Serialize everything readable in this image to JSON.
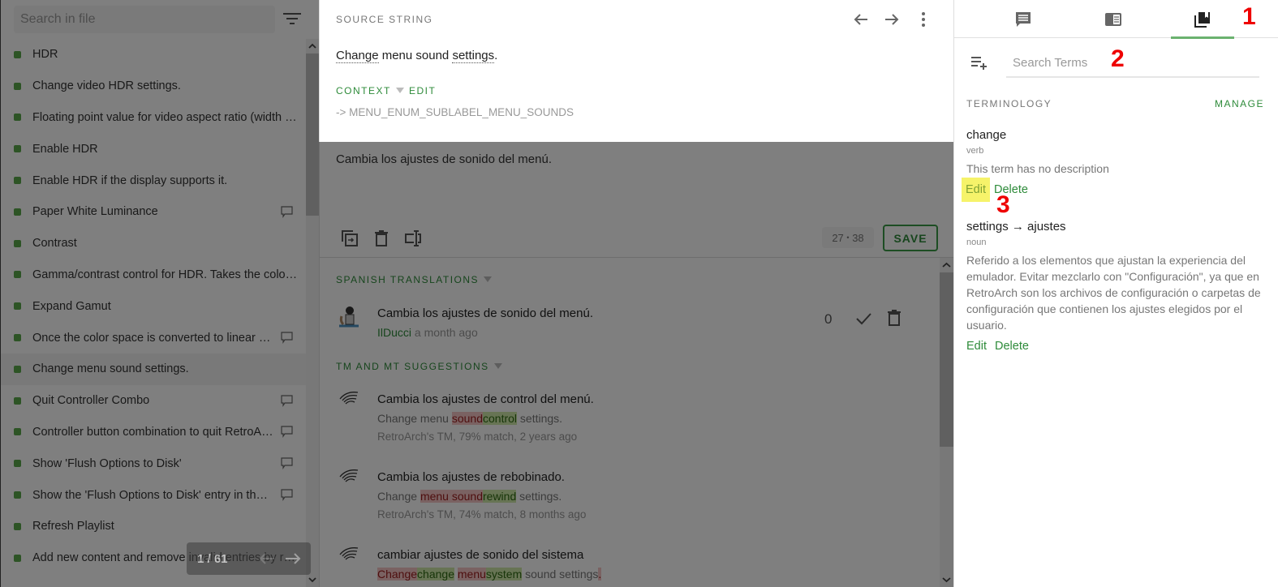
{
  "sidebar": {
    "search_placeholder": "Search in file",
    "filter_icon": "filter-icon",
    "items": [
      {
        "label": "HDR",
        "comment": false,
        "selected": false
      },
      {
        "label": "Change video HDR settings.",
        "comment": false,
        "selected": false
      },
      {
        "label": "Floating point value for video aspect ratio (width / ...",
        "comment": false,
        "selected": false
      },
      {
        "label": "Enable HDR",
        "comment": false,
        "selected": false
      },
      {
        "label": "Enable HDR if the display supports it.",
        "comment": false,
        "selected": false
      },
      {
        "label": "Paper White Luminance",
        "comment": true,
        "selected": false
      },
      {
        "label": "Contrast",
        "comment": false,
        "selected": false
      },
      {
        "label": "Gamma/contrast control for HDR. Takes the colors...",
        "comment": false,
        "selected": false
      },
      {
        "label": "Expand Gamut",
        "comment": false,
        "selected": false
      },
      {
        "label": "Once the color space is converted to linear spa...",
        "comment": true,
        "selected": false
      },
      {
        "label": "Change menu sound settings.",
        "comment": false,
        "selected": true
      },
      {
        "label": "Quit Controller Combo",
        "comment": true,
        "selected": false
      },
      {
        "label": "Controller button combination to quit RetroArch.",
        "comment": true,
        "selected": false
      },
      {
        "label": "Show 'Flush Options to Disk'",
        "comment": true,
        "selected": false
      },
      {
        "label": "Show the 'Flush Options to Disk' entry in the 'Op...",
        "comment": true,
        "selected": false
      },
      {
        "label": "Refresh Playlist",
        "comment": false,
        "selected": false
      },
      {
        "label": "Add new content and remove invalid entries by rep...",
        "comment": false,
        "selected": false
      }
    ],
    "pager": {
      "text": "1 / 61"
    }
  },
  "source": {
    "title": "SOURCE STRING",
    "text_parts": [
      {
        "text": "Change",
        "term": true
      },
      {
        "text": " menu sound ",
        "term": false
      },
      {
        "text": "settings",
        "term": true
      },
      {
        "text": ".",
        "term": false
      }
    ],
    "context_label": "CONTEXT",
    "edit_label": "EDIT",
    "context_key": "-> MENU_ENUM_SUBLABEL_MENU_SOUNDS"
  },
  "editor": {
    "value": "Cambia los ajustes de sonido del menú.",
    "counter_current": "27",
    "counter_separator": "•",
    "counter_max": "38",
    "save_label": "SAVE"
  },
  "translations": {
    "title": "SPANISH TRANSLATIONS",
    "items": [
      {
        "text": "Cambia los ajustes de sonido del menú.",
        "user": "IlDucci",
        "time": "a month ago",
        "votes": "0"
      }
    ]
  },
  "suggestions": {
    "title": "TM AND MT SUGGESTIONS",
    "items": [
      {
        "translation": "Cambia los ajustes de control del menú.",
        "source_diff": [
          {
            "t": "Change menu ",
            "k": ""
          },
          {
            "t": "sound",
            "k": "del"
          },
          {
            "t": "control",
            "k": "ins"
          },
          {
            "t": " settings.",
            "k": ""
          }
        ],
        "meta": "RetroArch's TM, 79% match, 2 years ago"
      },
      {
        "translation": "Cambia los ajustes de rebobinado.",
        "source_diff": [
          {
            "t": "Change ",
            "k": ""
          },
          {
            "t": "menu sound",
            "k": "del"
          },
          {
            "t": "rewind",
            "k": "ins"
          },
          {
            "t": " settings.",
            "k": ""
          }
        ],
        "meta": "RetroArch's TM, 74% match, 8 months ago"
      },
      {
        "translation": "cambiar ajustes de sonido del sistema",
        "source_diff": [
          {
            "t": "Change",
            "k": "del"
          },
          {
            "t": "change",
            "k": "ins"
          },
          {
            "t": " ",
            "k": ""
          },
          {
            "t": "menu",
            "k": "del"
          },
          {
            "t": "system",
            "k": "ins"
          },
          {
            "t": " sound settings",
            "k": ""
          },
          {
            "t": ".",
            "k": "del"
          }
        ],
        "meta": ""
      }
    ]
  },
  "right_panel": {
    "tabs": [
      {
        "name": "comments",
        "icon": "comment-icon",
        "active": false
      },
      {
        "name": "string-info",
        "icon": "info-panel-icon",
        "active": false
      },
      {
        "name": "terminology",
        "icon": "glossary-icon",
        "active": true
      }
    ],
    "search_placeholder": "Search Terms",
    "section_title": "TERMINOLOGY",
    "manage_label": "MANAGE",
    "terms": [
      {
        "name": "change",
        "pos": "verb",
        "description": "This term has no description",
        "edit_label": "Edit",
        "delete_label": "Delete",
        "edit_highlighted": true
      },
      {
        "name": "settings → ajustes",
        "pos": "noun",
        "description": "Referido a los elementos que ajustan la experiencia del emulador. Evitar mezclarlo con \"Configuración\", ya que en RetroArch son los archivos de configuración o carpetas de configuración que contienen los ajustes elegidos por el usuario.",
        "edit_label": "Edit",
        "delete_label": "Delete",
        "edit_highlighted": false
      }
    ]
  },
  "annotations": [
    "1",
    "2",
    "3"
  ],
  "colors": {
    "accent_green": "#2e8b3a",
    "status_dot": "#5aa94b",
    "tab_underline": "#6bb26f",
    "diff_delete_bg": "#f5c4c4",
    "diff_insert_bg": "#cfe8a8",
    "annotation_red": "#ee0000",
    "highlight_yellow": "#f6f36a"
  }
}
